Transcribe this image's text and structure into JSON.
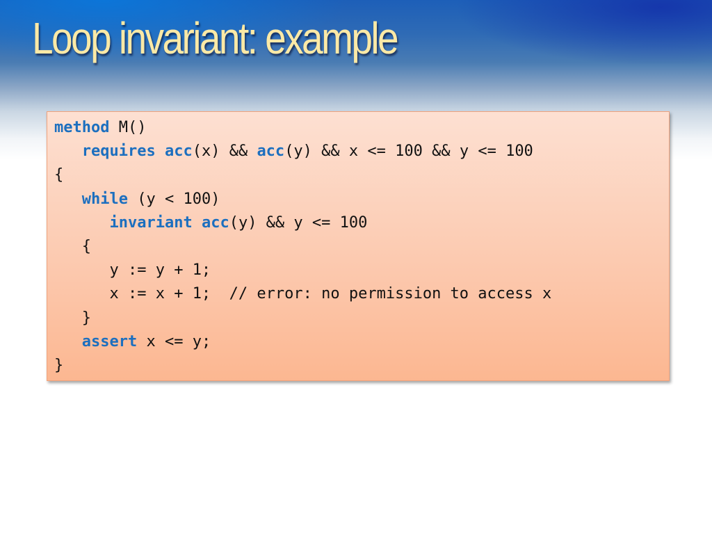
{
  "slide": {
    "title": "Loop invariant:  example"
  },
  "colors": {
    "title_text": "#fbe9a6",
    "keyword": "#1c6fbf",
    "code_text": "#111111",
    "code_box_top": "#fde0d2",
    "code_box_bottom": "#fcb791"
  },
  "code": {
    "lines": [
      {
        "indent": "",
        "tokens": [
          {
            "t": "method",
            "kw": true
          },
          {
            "t": " M()",
            "kw": false
          }
        ]
      },
      {
        "indent": "   ",
        "tokens": [
          {
            "t": "requires",
            "kw": true
          },
          {
            "t": " ",
            "kw": false
          },
          {
            "t": "acc",
            "kw": true
          },
          {
            "t": "(x) && ",
            "kw": false
          },
          {
            "t": "acc",
            "kw": true
          },
          {
            "t": "(y) && x <= 100 && y <= 100",
            "kw": false
          }
        ]
      },
      {
        "indent": "",
        "tokens": [
          {
            "t": "{",
            "kw": false
          }
        ]
      },
      {
        "indent": "   ",
        "tokens": [
          {
            "t": "while",
            "kw": true
          },
          {
            "t": " (y < 100)",
            "kw": false
          }
        ]
      },
      {
        "indent": "      ",
        "tokens": [
          {
            "t": "invariant",
            "kw": true
          },
          {
            "t": " ",
            "kw": false
          },
          {
            "t": "acc",
            "kw": true
          },
          {
            "t": "(y) && y <= 100",
            "kw": false
          }
        ]
      },
      {
        "indent": "   ",
        "tokens": [
          {
            "t": "{",
            "kw": false
          }
        ]
      },
      {
        "indent": "      ",
        "tokens": [
          {
            "t": "y := y + 1;",
            "kw": false
          }
        ]
      },
      {
        "indent": "      ",
        "tokens": [
          {
            "t": "x := x + 1;  // error: no permission to access x",
            "kw": false
          }
        ]
      },
      {
        "indent": "   ",
        "tokens": [
          {
            "t": "}",
            "kw": false
          }
        ]
      },
      {
        "indent": "   ",
        "tokens": [
          {
            "t": "assert",
            "kw": true
          },
          {
            "t": " x <= y;",
            "kw": false
          }
        ]
      },
      {
        "indent": "",
        "tokens": [
          {
            "t": "}",
            "kw": false
          }
        ]
      }
    ]
  }
}
